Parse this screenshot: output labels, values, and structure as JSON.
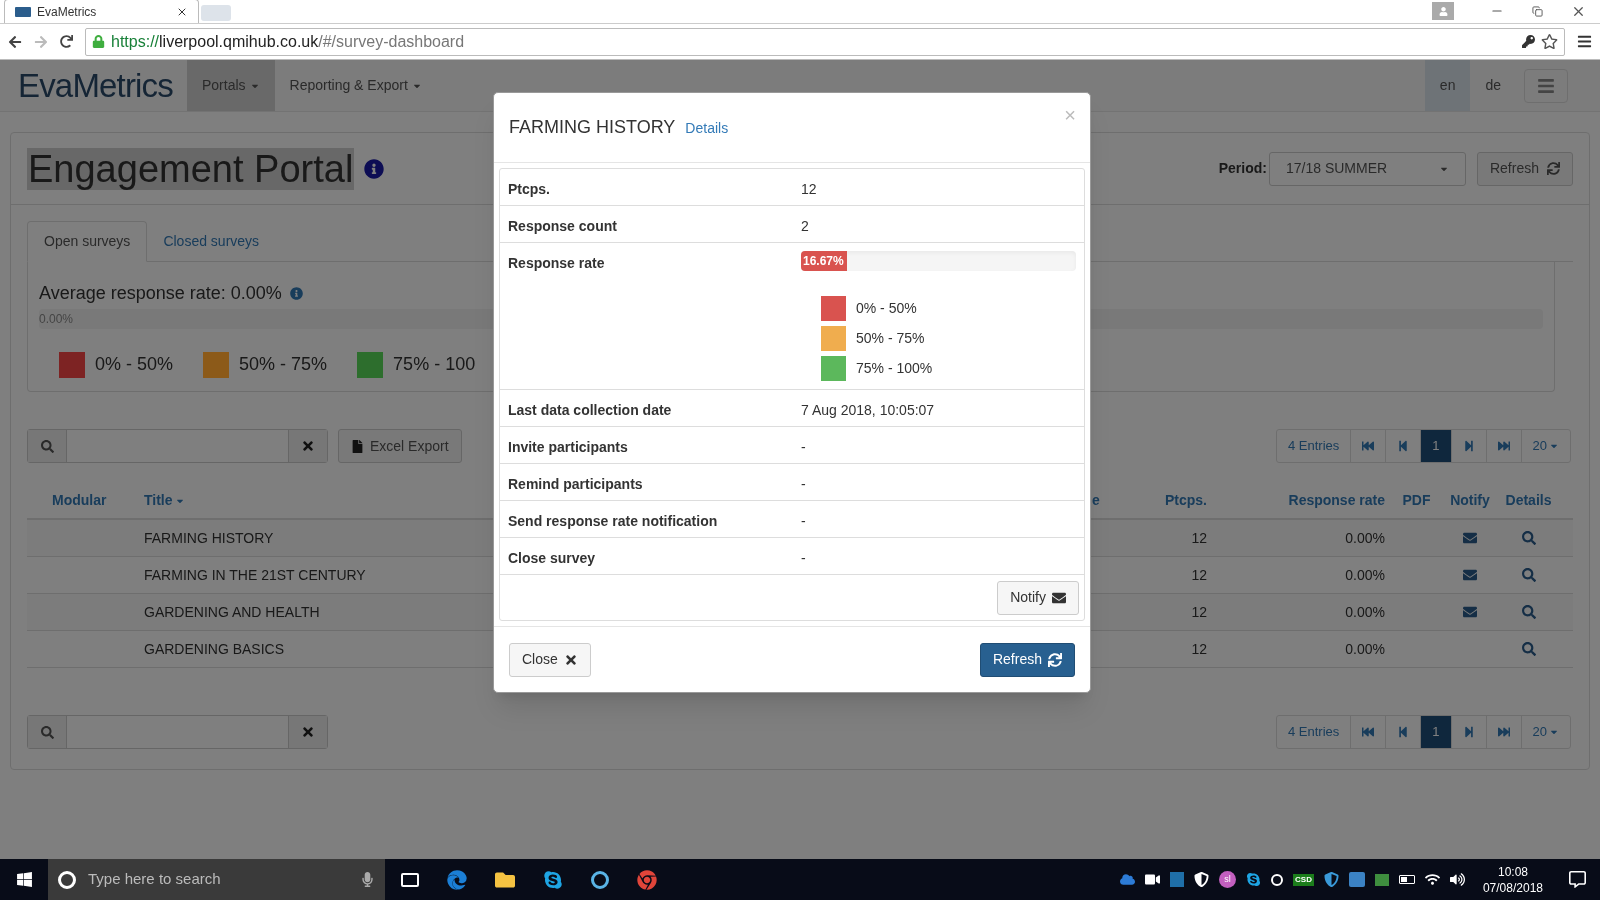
{
  "browser": {
    "tab_title": "EvaMetrics",
    "url": {
      "scheme": "https://",
      "host": "liverpool.qmihub.co.uk",
      "path": "/#/survey-dashboard"
    }
  },
  "navbar": {
    "logo": "EvaMetrics",
    "menus": [
      {
        "label": "Portals",
        "selected": true
      },
      {
        "label": "Reporting & Export",
        "selected": false
      }
    ],
    "languages": [
      {
        "label": "en",
        "selected": true
      },
      {
        "label": "de",
        "selected": false
      }
    ]
  },
  "page": {
    "title": "Engagement Portal",
    "period_label": "Period:",
    "period_value": "17/18 SUMMER",
    "refresh": "Refresh",
    "tabs": [
      {
        "label": "Open surveys",
        "selected": true
      },
      {
        "label": "Closed surveys",
        "selected": false
      }
    ],
    "average": {
      "label": "Average response rate: 0.00%",
      "bar_label": "0.00%",
      "level": 0
    },
    "legend": [
      {
        "label": "0% - 50%",
        "color": "#7d2323"
      },
      {
        "label": "50% - 75%",
        "color": "#8c5a19"
      },
      {
        "label": "75% - 100",
        "color": "#2d6e2d"
      }
    ],
    "excel_export": "Excel Export",
    "pagers": [
      {
        "entries": "4 Entries",
        "pages": [
          {
            "label": "1",
            "selected": true
          }
        ],
        "page_size": "20"
      },
      {
        "entries": "4 Entries",
        "pages": [
          {
            "label": "1",
            "selected": true
          }
        ],
        "page_size": "20"
      }
    ],
    "table": {
      "columns": [
        "Modular",
        "Title",
        "e",
        "Ptcps.",
        "Response rate",
        "PDF",
        "Notify",
        "Details"
      ],
      "rows": [
        {
          "title": "FARMING HISTORY",
          "ptcps": "12",
          "rate": "0.00%",
          "notify": true
        },
        {
          "title": "FARMING IN THE 21ST CENTURY",
          "ptcps": "12",
          "rate": "0.00%",
          "notify": true
        },
        {
          "title": "GARDENING AND HEALTH",
          "ptcps": "12",
          "rate": "0.00%",
          "notify": true
        },
        {
          "title": "GARDENING BASICS",
          "ptcps": "12",
          "rate": "0.00%",
          "notify": false
        }
      ]
    }
  },
  "modal": {
    "title": "FARMING HISTORY",
    "link": "Details",
    "close_mark": "×",
    "rows": [
      {
        "kind": "text",
        "label": "Ptcps.",
        "value": "12"
      },
      {
        "kind": "text",
        "label": "Response count",
        "value": "2"
      },
      {
        "kind": "bar",
        "label": "Response rate",
        "value": "16.67%",
        "level": 0.1667
      },
      {
        "kind": "text",
        "label": "Last data collection date",
        "value": "7 Aug 2018, 10:05:07"
      },
      {
        "kind": "text",
        "label": "Invite participants",
        "value": "-"
      },
      {
        "kind": "text",
        "label": "Remind participants",
        "value": "-"
      },
      {
        "kind": "text",
        "label": "Send response rate notification",
        "value": "-"
      },
      {
        "kind": "text",
        "label": "Close survey",
        "value": "-"
      }
    ],
    "legend": [
      {
        "label": "0% - 50%",
        "color": "#d9534f"
      },
      {
        "label": "50% - 75%",
        "color": "#f0ad4e"
      },
      {
        "label": "75% - 100%",
        "color": "#5cb85c"
      }
    ],
    "notify": "Notify",
    "close": "Close",
    "refresh": "Refresh"
  },
  "taskbar": {
    "search_placeholder": "Type here to search",
    "tray_badge": "sl",
    "tray_tag": "CSD",
    "time": "10:08",
    "date": "07/08/2018"
  }
}
